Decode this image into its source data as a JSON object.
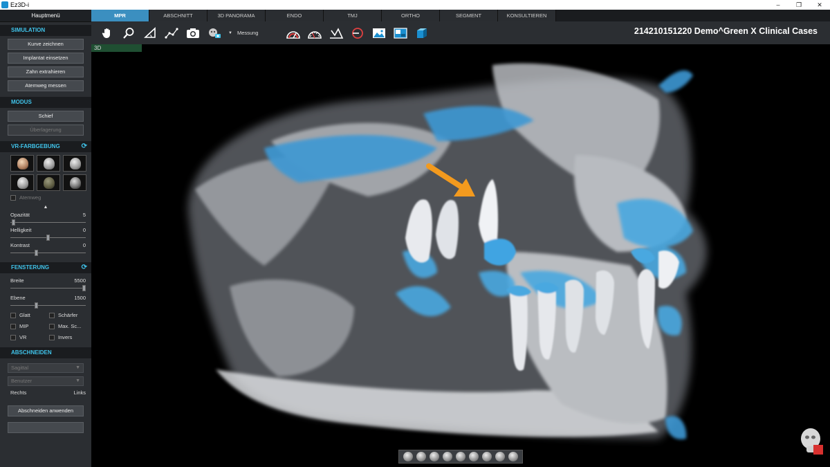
{
  "window": {
    "title": "Ez3D-i",
    "controls": [
      "–",
      "❐",
      "✕"
    ]
  },
  "sidebar": {
    "header": "Hauptmenü",
    "simulation": {
      "title": "SIMULATION",
      "buttons": [
        "Kurve zeichnen",
        "Implantat einsetzen",
        "Zahn extrahieren",
        "Atemweg messen"
      ]
    },
    "modus": {
      "title": "MODUS",
      "buttons": [
        "Schief",
        "Überlagerung"
      ]
    },
    "vr": {
      "title": "VR-FARBGEBUNG",
      "presets": [
        "preset-1",
        "preset-2",
        "preset-3",
        "preset-4",
        "preset-5",
        "preset-6"
      ],
      "airway_label": "Atemweg",
      "opacity_label": "Opazität",
      "opacity_value": "5",
      "opacity_fraction": 0.05,
      "brightness_label": "Helligkeit",
      "brightness_value": "0",
      "brightness_fraction": 0.5,
      "contrast_label": "Kontrast",
      "contrast_value": "0",
      "contrast_fraction": 0.35
    },
    "windowing": {
      "title": "FENSTERUNG",
      "width_label": "Breite",
      "width_value": "5500",
      "width_fraction": 0.98,
      "level_label": "Ebene",
      "level_value": "1500",
      "level_fraction": 0.35,
      "checkboxes": [
        "Glatt",
        "Schärfer",
        "MIP",
        "Max. Sc...",
        "VR",
        "Invers"
      ]
    },
    "cut": {
      "title": "ABSCHNEIDEN",
      "dropdown1": "Sagittal",
      "dropdown2": "Benutzer",
      "right_label": "Rechts",
      "left_label": "Links",
      "apply_button": "Abschneiden anwenden"
    }
  },
  "tabs": [
    "MPR",
    "ABSCHNITT",
    "3D PANORAMA",
    "ENDO",
    "TMJ",
    "ORTHO",
    "SEGMENT",
    "KONSULTIEREN"
  ],
  "active_tab": "MPR",
  "toolbar": {
    "measure_label": "Messung"
  },
  "patient": "214210151220  Demo^Green X Clinical Cases",
  "viewport": {
    "label": "3D"
  },
  "colors": {
    "accent": "#40c3ea",
    "tab_active": "#3b8fc0",
    "arrow": "#f39a1e",
    "bone_blue": "#4aa8e0"
  }
}
